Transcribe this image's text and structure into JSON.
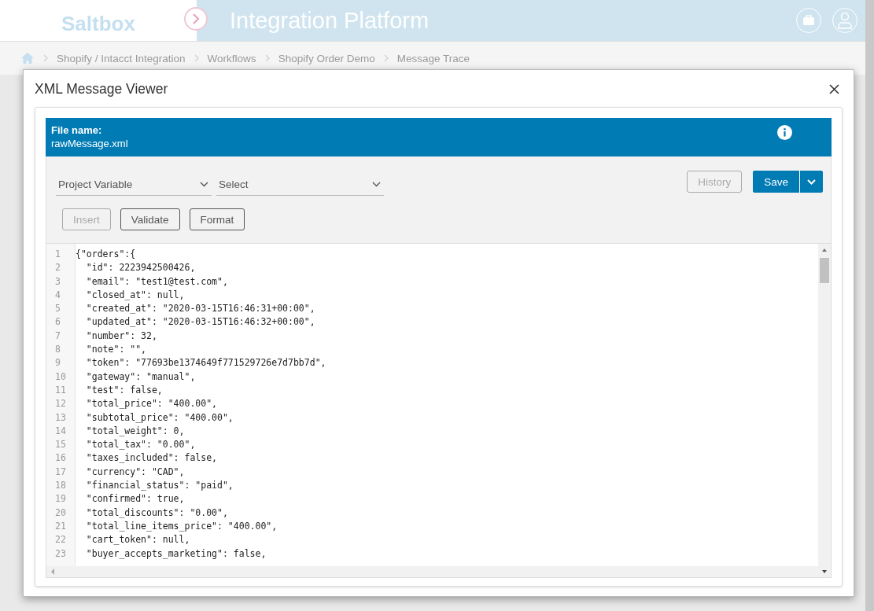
{
  "header": {
    "logo_text": "Saltbox",
    "title": "Integration Platform"
  },
  "breadcrumb": [
    "Shopify / Intacct Integration",
    "Workflows",
    "Shopify Order Demo",
    "Message Trace"
  ],
  "dialog": {
    "title": "XML Message Viewer",
    "file_label": "File name:",
    "file_name": "rawMessage.xml",
    "selects": [
      {
        "value": "Project Variable"
      },
      {
        "value": "Select"
      }
    ],
    "history_button": {
      "label": "History",
      "disabled": true
    },
    "save_button": {
      "label": "Save"
    },
    "action_buttons": [
      {
        "label": "Insert",
        "disabled": true
      },
      {
        "label": "Validate",
        "disabled": false
      },
      {
        "label": "Format",
        "disabled": false
      }
    ],
    "code_lines": [
      {
        "number": "1",
        "text": "{\"orders\":{"
      },
      {
        "number": "2",
        "text": "  \"id\": 2223942500426,"
      },
      {
        "number": "3",
        "text": "  \"email\": \"test1@test.com\","
      },
      {
        "number": "4",
        "text": "  \"closed_at\": null,"
      },
      {
        "number": "5",
        "text": "  \"created_at\": \"2020-03-15T16:46:31+00:00\","
      },
      {
        "number": "6",
        "text": "  \"updated_at\": \"2020-03-15T16:46:32+00:00\","
      },
      {
        "number": "7",
        "text": "  \"number\": 32,"
      },
      {
        "number": "8",
        "text": "  \"note\": \"\","
      },
      {
        "number": "9",
        "text": "  \"token\": \"77693be1374649f771529726e7d7bb7d\","
      },
      {
        "number": "10",
        "text": "  \"gateway\": \"manual\","
      },
      {
        "number": "11",
        "text": "  \"test\": false,"
      },
      {
        "number": "12",
        "text": "  \"total_price\": \"400.00\","
      },
      {
        "number": "13",
        "text": "  \"subtotal_price\": \"400.00\","
      },
      {
        "number": "14",
        "text": "  \"total_weight\": 0,"
      },
      {
        "number": "15",
        "text": "  \"total_tax\": \"0.00\","
      },
      {
        "number": "16",
        "text": "  \"taxes_included\": false,"
      },
      {
        "number": "17",
        "text": "  \"currency\": \"CAD\","
      },
      {
        "number": "18",
        "text": "  \"financial_status\": \"paid\","
      },
      {
        "number": "19",
        "text": "  \"confirmed\": true,"
      },
      {
        "number": "20",
        "text": "  \"total_discounts\": \"0.00\","
      },
      {
        "number": "21",
        "text": "  \"total_line_items_price\": \"400.00\","
      },
      {
        "number": "22",
        "text": "  \"cart_token\": null,"
      },
      {
        "number": "23",
        "text": "  \"buyer_accepts_marketing\": false,"
      }
    ]
  }
}
